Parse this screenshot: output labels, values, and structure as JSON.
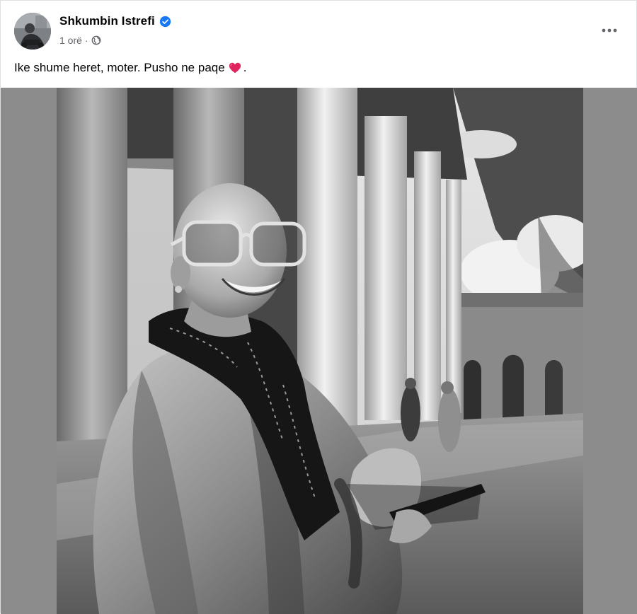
{
  "post": {
    "author": {
      "name": "Shkumbin Istrefi",
      "verified": true,
      "avatar_icon": "profile-avatar"
    },
    "meta": {
      "time": "1 orë",
      "separator": "·",
      "audience_icon": "globe-icon"
    },
    "caption": {
      "text": "Ike shume heret, moter. Pusho ne paqe",
      "emoji": "red-heart-icon",
      "trailing": "."
    },
    "more_icon": "more-horizontal-icon",
    "photo": {
      "style": "black-and-white",
      "colors": {
        "side_panel": "#8c8c8c"
      }
    }
  },
  "colors": {
    "text_primary": "#050505",
    "text_secondary": "#65676b",
    "verified_blue": "#1877f2",
    "heart_red": "#e0245e"
  }
}
